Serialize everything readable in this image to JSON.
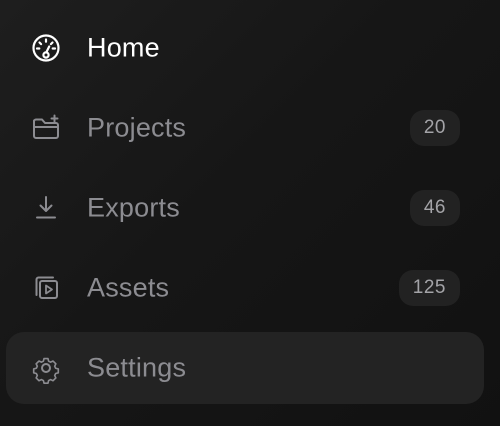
{
  "nav": {
    "items": [
      {
        "label": "Home",
        "icon": "gauge-icon",
        "active": true
      },
      {
        "label": "Projects",
        "icon": "folder-plus-icon",
        "count": "20"
      },
      {
        "label": "Exports",
        "icon": "download-icon",
        "count": "46"
      },
      {
        "label": "Assets",
        "icon": "media-stack-icon",
        "count": "125"
      },
      {
        "label": "Settings",
        "icon": "gear-icon",
        "hovered": true
      }
    ]
  },
  "colors": {
    "background": "#161616",
    "active_text": "#ffffff",
    "muted_text": "#8c8c91",
    "badge_bg": "#222222",
    "hover_bg": "#232323"
  }
}
